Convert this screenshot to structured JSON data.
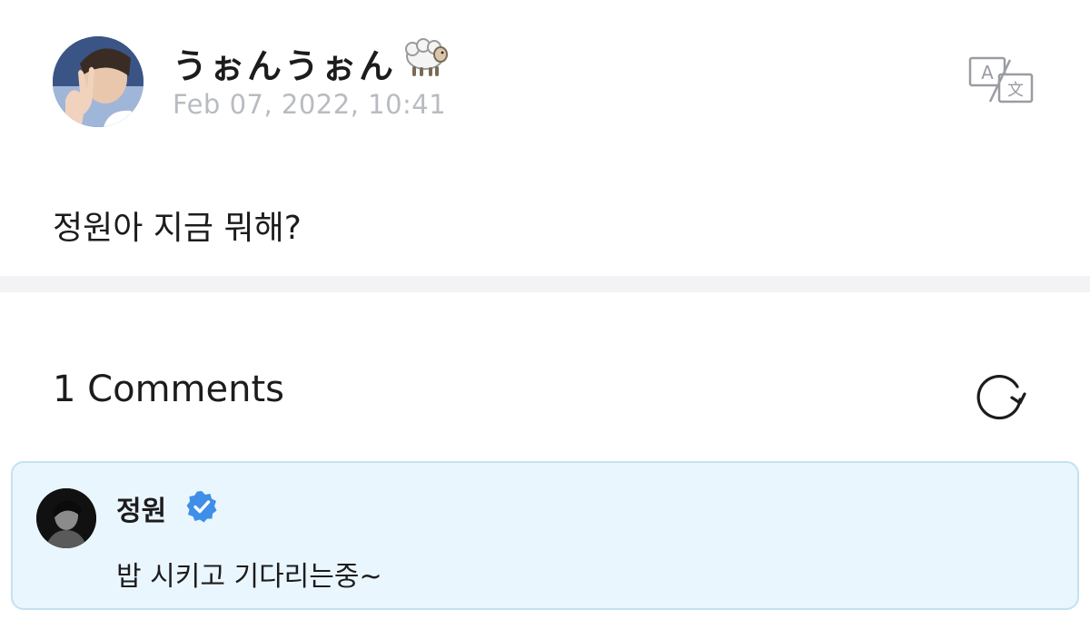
{
  "post": {
    "author_name": "うぉんうぉん",
    "author_emoji_icon": "sheep-icon",
    "timestamp": "Feb 07, 2022, 10:41",
    "body": "정원아 지금 뭐해?",
    "translate_icon": "translate-icon"
  },
  "comments": {
    "heading": "1 Comments",
    "refresh_icon": "refresh-icon",
    "items": [
      {
        "author": "정원",
        "verified": true,
        "text": "밥 시키고 기다리는중~"
      }
    ]
  },
  "colors": {
    "text_primary": "#1c1c1e",
    "timestamp_gray": "#b8bbc2",
    "divider": "#f3f3f6",
    "comment_bg": "#eaf6fd",
    "comment_border": "#c4e1f0",
    "verified_blue": "#3f8ee8"
  }
}
